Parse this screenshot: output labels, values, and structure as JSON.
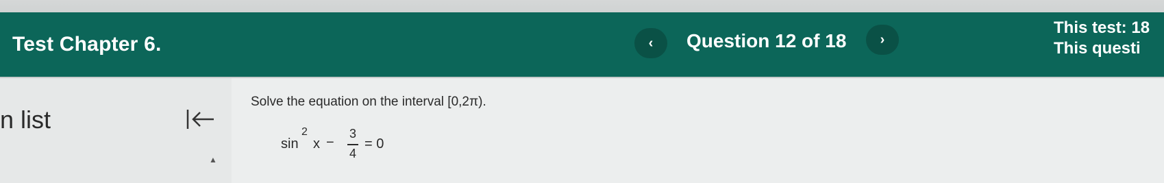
{
  "header": {
    "title": "Test Chapter 6.",
    "question_counter": "Question 12 of 18",
    "prev_glyph": "‹",
    "next_glyph": "›",
    "this_test_label": "This test: 18",
    "this_question_label": "This questi"
  },
  "left_panel": {
    "label": "n list",
    "scroll_up_glyph": "▲"
  },
  "question": {
    "prompt": "Solve the equation on the interval [0,2π).",
    "equation": {
      "func": "sin",
      "exponent": "2",
      "variable": "x",
      "minus": "−",
      "numerator": "3",
      "denominator": "4",
      "equals": "= 0"
    }
  },
  "colors": {
    "header_bg": "#0c6659",
    "nav_button_bg": "#0a5146",
    "header_text": "#ffffff"
  }
}
